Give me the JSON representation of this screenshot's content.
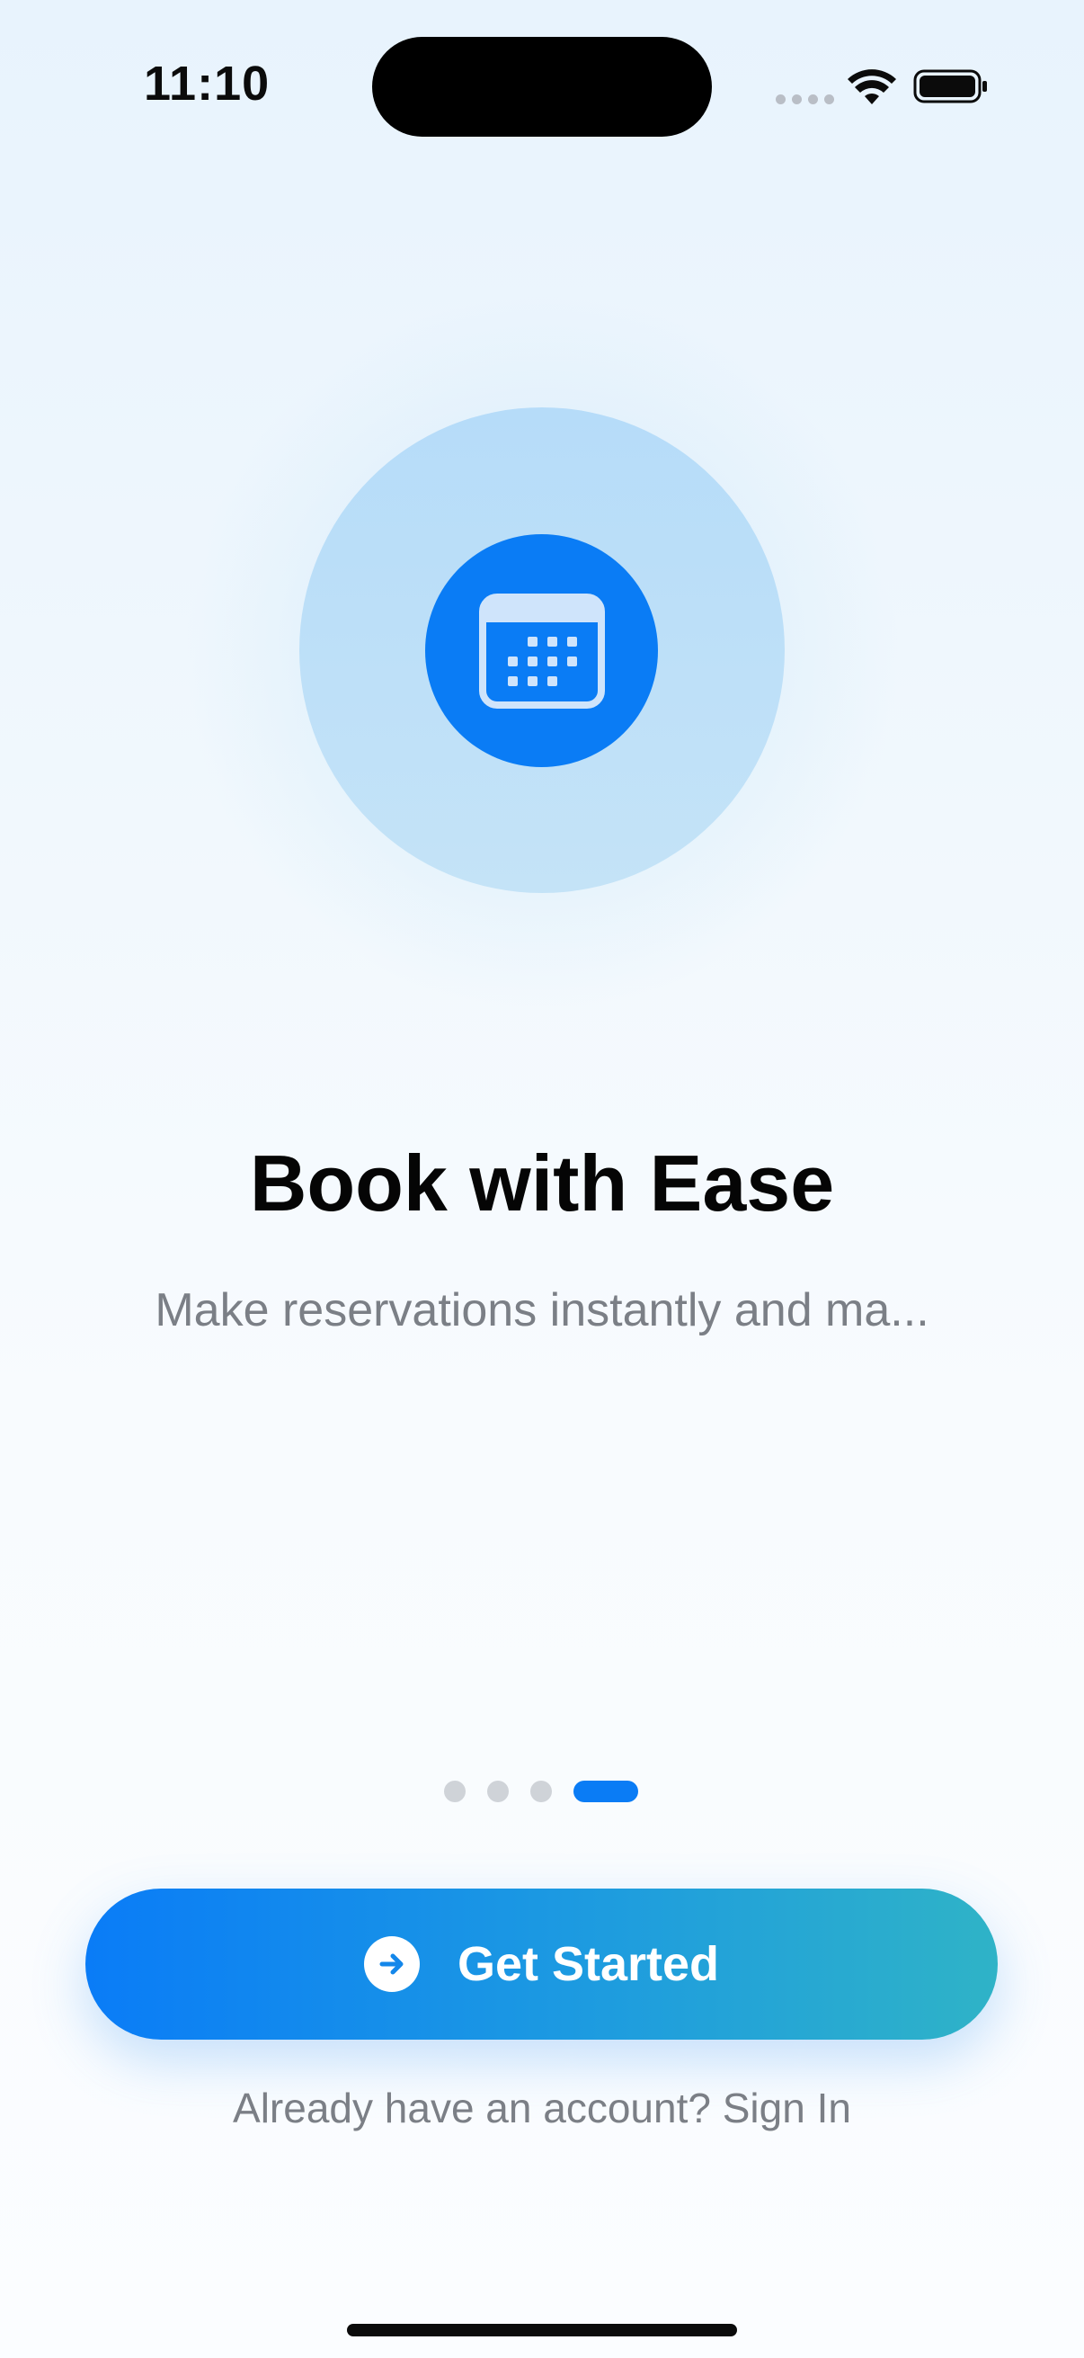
{
  "status_bar": {
    "time": "11:10",
    "icons": [
      "cellular-signal-icon",
      "wifi-icon",
      "battery-icon"
    ]
  },
  "hero": {
    "icon": "calendar-icon",
    "accent_color": "#0A7CF5"
  },
  "onboarding": {
    "title": "Book with Ease",
    "subtitle": "Make reservations instantly and ma...",
    "page_count": 4,
    "current_page": 4
  },
  "cta": {
    "label": "Get Started",
    "icon": "arrow-right-circle-icon",
    "gradient": [
      "#0A7CF7",
      "#2FB3C7"
    ]
  },
  "signin": {
    "text": "Already have an account? Sign In"
  }
}
